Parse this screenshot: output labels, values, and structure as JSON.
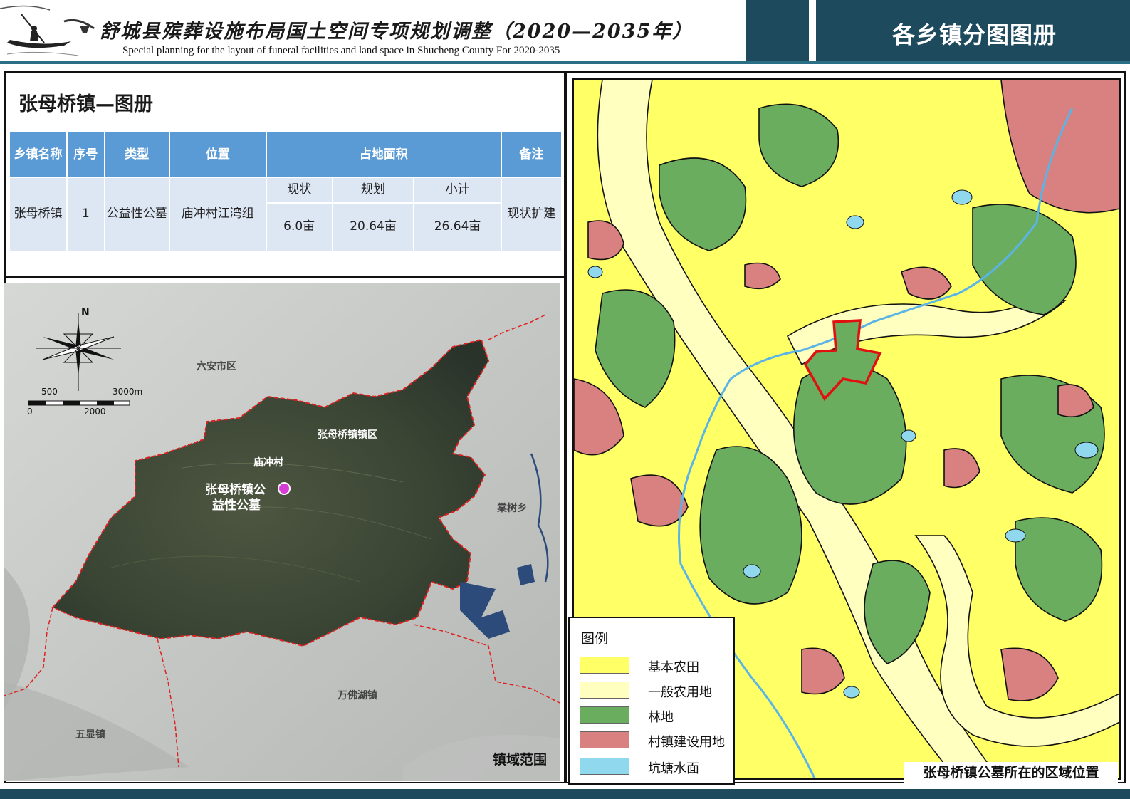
{
  "header": {
    "title_cn": "舒城县殡葬设施布局国土空间专项规划调整（2020—2035年）",
    "title_en": "Special planning for the layout of funeral facilities and land space in Shucheng County For 2020-2035",
    "right_title": "各乡镇分图图册"
  },
  "section": {
    "title": "张母桥镇—图册"
  },
  "table": {
    "headers": {
      "town": "乡镇名称",
      "no": "序号",
      "type": "类型",
      "location": "位置",
      "area": "占地面积",
      "remark": "备注"
    },
    "subheaders": {
      "current": "现状",
      "planned": "规划",
      "subtotal": "小计"
    },
    "row": {
      "town": "张母桥镇",
      "no": "1",
      "type": "公益性公墓",
      "location": "庙冲村江湾组",
      "current": "6.0亩",
      "planned": "20.64亩",
      "subtotal": "26.64亩",
      "remark": "现状扩建"
    }
  },
  "sat_map": {
    "compass_label": "N",
    "scale_top_left": "500",
    "scale_top_right": "3000m",
    "scale_bottom_left": "0",
    "scale_bottom_mid": "2000",
    "labels": {
      "liuan": "六安市区",
      "town_area": "张母桥镇镇区",
      "miaochong": "庙冲村",
      "cemetery_line1": "张母桥镇公",
      "cemetery_line2": "益性公墓",
      "tangshu": "棠树乡",
      "wanfohu": "万佛湖镇",
      "wuxian": "五显镇"
    },
    "caption": "镇域范围",
    "boundary_color": "#e0201e",
    "marker_color": "#d63cd6"
  },
  "lu_map": {
    "legend_title": "图例",
    "legend": [
      {
        "label": "基本农田",
        "color": "#ffff66"
      },
      {
        "label": "一般农用地",
        "color": "#ffffc0"
      },
      {
        "label": "林地",
        "color": "#6aad5e"
      },
      {
        "label": "村镇建设用地",
        "color": "#d98080"
      },
      {
        "label": "坑塘水面",
        "color": "#8fd8ee"
      }
    ],
    "caption": "张母桥镇公墓所在的区域位置",
    "site_outline_color": "#e01010"
  }
}
